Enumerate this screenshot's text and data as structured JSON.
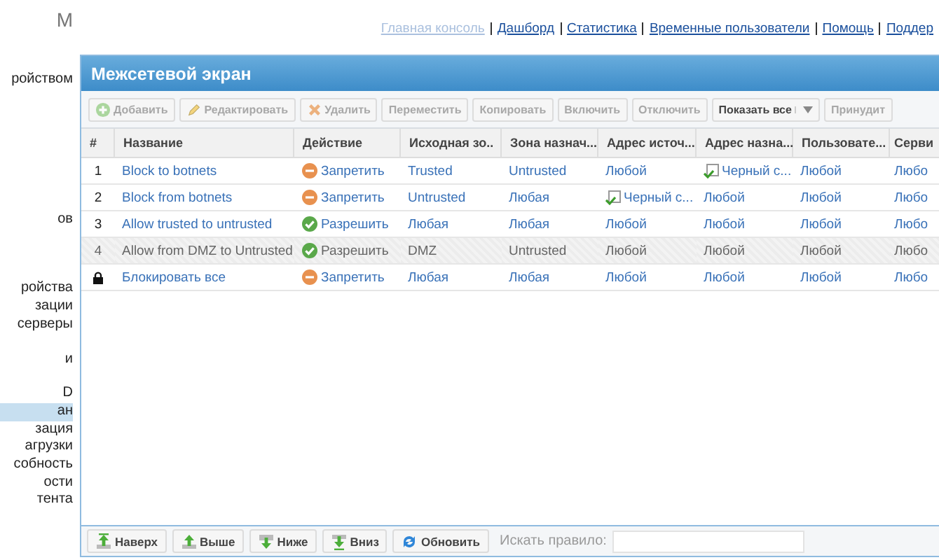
{
  "sidebar": {
    "title": "М",
    "sections": [
      {
        "items": [
          {
            "label": "ройством",
            "selected": false
          }
        ]
      },
      {
        "items": [
          {
            "label": "ов",
            "selected": false
          }
        ]
      },
      {
        "items": [
          {
            "label": "ройства",
            "selected": false
          },
          {
            "label": "зации",
            "selected": false
          },
          {
            "label": "серверы",
            "selected": false
          }
        ]
      },
      {
        "items": [
          {
            "label": "и",
            "selected": false
          }
        ]
      },
      {
        "items": [
          {
            "label": "D",
            "selected": false
          }
        ]
      },
      {
        "items": [
          {
            "label": "ан",
            "selected": true
          },
          {
            "label": "зация",
            "selected": false
          },
          {
            "label": "агрузки",
            "selected": false
          },
          {
            "label": "собность",
            "selected": false
          },
          {
            "label": "ости",
            "selected": false
          },
          {
            "label": "тента",
            "selected": false
          }
        ]
      }
    ]
  },
  "top_links": [
    {
      "label": "Главная консоль",
      "disabled": true
    },
    {
      "label": "Дашборд",
      "disabled": false
    },
    {
      "label": "Статистика",
      "disabled": false
    },
    {
      "label": "Временные пользователи",
      "disabled": false
    },
    {
      "label": "Помощь",
      "disabled": false
    },
    {
      "label": "Поддер",
      "disabled": false
    }
  ],
  "panel": {
    "title": "Межсетевой экран"
  },
  "toolbar": [
    {
      "label": "Добавить",
      "disabled": true,
      "kind": "add"
    },
    {
      "label": "Редактировать",
      "disabled": true,
      "kind": "edit"
    },
    {
      "label": "Удалить",
      "disabled": true,
      "kind": "delete"
    },
    {
      "label": "Переместить",
      "disabled": true,
      "kind": "plain"
    },
    {
      "label": "Копировать",
      "disabled": true,
      "kind": "plain"
    },
    {
      "label": "Включить",
      "disabled": true,
      "kind": "plain"
    },
    {
      "label": "Отключить",
      "disabled": true,
      "kind": "plain"
    },
    {
      "label": "Показать все",
      "disabled": false,
      "kind": "dropdown"
    },
    {
      "label": "Принудит",
      "disabled": true,
      "kind": "plain"
    }
  ],
  "table": {
    "columns": [
      "#",
      "Название",
      "Действие",
      "Исходная зо..",
      "Зона назнач...",
      "Адрес источ...",
      "Адрес назна...",
      "Пользовате...",
      "Серви"
    ],
    "rows": [
      {
        "disabled": false,
        "cells": [
          {
            "kind": "number",
            "text": "1"
          },
          {
            "kind": "link",
            "text": "Block to botnets"
          },
          {
            "kind": "deny",
            "text": "Запретить"
          },
          {
            "kind": "link",
            "text": "Trusted"
          },
          {
            "kind": "link",
            "text": "Untrusted"
          },
          {
            "kind": "link",
            "text": "Любой"
          },
          {
            "kind": "list",
            "text": "Черный с..."
          },
          {
            "kind": "link",
            "text": "Любой"
          },
          {
            "kind": "link",
            "text": "Любо"
          }
        ]
      },
      {
        "disabled": false,
        "cells": [
          {
            "kind": "number",
            "text": "2"
          },
          {
            "kind": "link",
            "text": "Block from botnets"
          },
          {
            "kind": "deny",
            "text": "Запретить"
          },
          {
            "kind": "link",
            "text": "Untrusted"
          },
          {
            "kind": "link",
            "text": "Любая"
          },
          {
            "kind": "list",
            "text": "Черный с..."
          },
          {
            "kind": "link",
            "text": "Любой"
          },
          {
            "kind": "link",
            "text": "Любой"
          },
          {
            "kind": "link",
            "text": "Любо"
          }
        ]
      },
      {
        "disabled": false,
        "cells": [
          {
            "kind": "number",
            "text": "3"
          },
          {
            "kind": "link",
            "text": "Allow trusted to untrusted"
          },
          {
            "kind": "allow",
            "text": "Разрешить"
          },
          {
            "kind": "link",
            "text": "Любая"
          },
          {
            "kind": "link",
            "text": "Любая"
          },
          {
            "kind": "link",
            "text": "Любой"
          },
          {
            "kind": "link",
            "text": "Любой"
          },
          {
            "kind": "link",
            "text": "Любой"
          },
          {
            "kind": "link",
            "text": "Любо"
          }
        ]
      },
      {
        "disabled": true,
        "cells": [
          {
            "kind": "number",
            "text": "4"
          },
          {
            "kind": "link",
            "text": "Allow from DMZ to Untrusted"
          },
          {
            "kind": "allow",
            "text": "Разрешить"
          },
          {
            "kind": "link",
            "text": "DMZ"
          },
          {
            "kind": "link",
            "text": "Untrusted"
          },
          {
            "kind": "link",
            "text": "Любой"
          },
          {
            "kind": "link",
            "text": "Любой"
          },
          {
            "kind": "link",
            "text": "Любой"
          },
          {
            "kind": "link",
            "text": "Любо"
          }
        ]
      },
      {
        "disabled": false,
        "cells": [
          {
            "kind": "lock"
          },
          {
            "kind": "link",
            "text": "Блокировать все"
          },
          {
            "kind": "deny",
            "text": "Запретить"
          },
          {
            "kind": "link",
            "text": "Любая"
          },
          {
            "kind": "link",
            "text": "Любая"
          },
          {
            "kind": "link",
            "text": "Любой"
          },
          {
            "kind": "link",
            "text": "Любой"
          },
          {
            "kind": "link",
            "text": "Любой"
          },
          {
            "kind": "link",
            "text": "Любо"
          }
        ]
      }
    ]
  },
  "bottom_toolbar": [
    {
      "label": "Наверх",
      "kind": "top"
    },
    {
      "label": "Выше",
      "kind": "up"
    },
    {
      "label": "Ниже",
      "kind": "down"
    },
    {
      "label": "Вниз",
      "kind": "bottom"
    },
    {
      "label": "Обновить",
      "kind": "refresh"
    }
  ],
  "search": {
    "label": "Искать правило:"
  }
}
